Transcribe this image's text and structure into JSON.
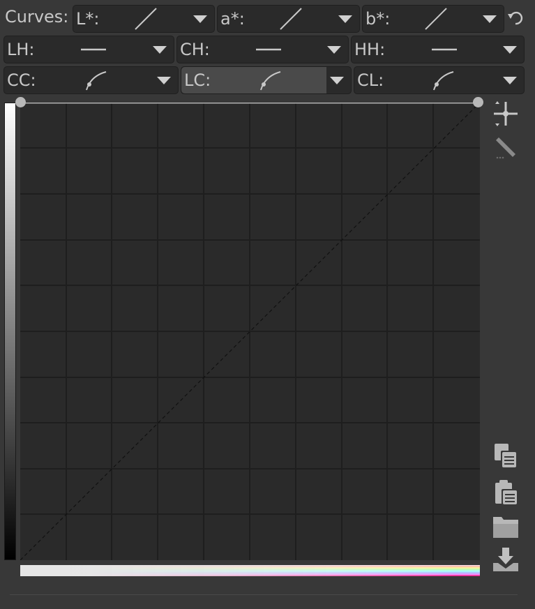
{
  "curves_label": "Curves:",
  "row1": [
    {
      "label": "L*:",
      "preview": "linear-icon"
    },
    {
      "label": "a*:",
      "preview": "linear-icon"
    },
    {
      "label": "b*:",
      "preview": "linear-icon"
    }
  ],
  "row2": [
    {
      "label": "LH:",
      "preview": "flat-icon"
    },
    {
      "label": "CH:",
      "preview": "flat-icon"
    },
    {
      "label": "HH:",
      "preview": "flat-icon"
    }
  ],
  "row3": [
    {
      "label": "CC:",
      "preview": "curve-icon"
    },
    {
      "label": "LC:",
      "preview": "curve-icon",
      "active": true
    },
    {
      "label": "CL:",
      "preview": "curve-icon"
    }
  ],
  "toolbar_icons": [
    "edit-point-icon",
    "pencil-icon",
    "copy-icon",
    "paste-icon",
    "open-folder-icon",
    "save-icon"
  ],
  "colors": {
    "background": "#383838",
    "curve_bg": "#2a2a2a",
    "grid": "#1e1e1e",
    "curve_line": "#b0b0b0"
  }
}
